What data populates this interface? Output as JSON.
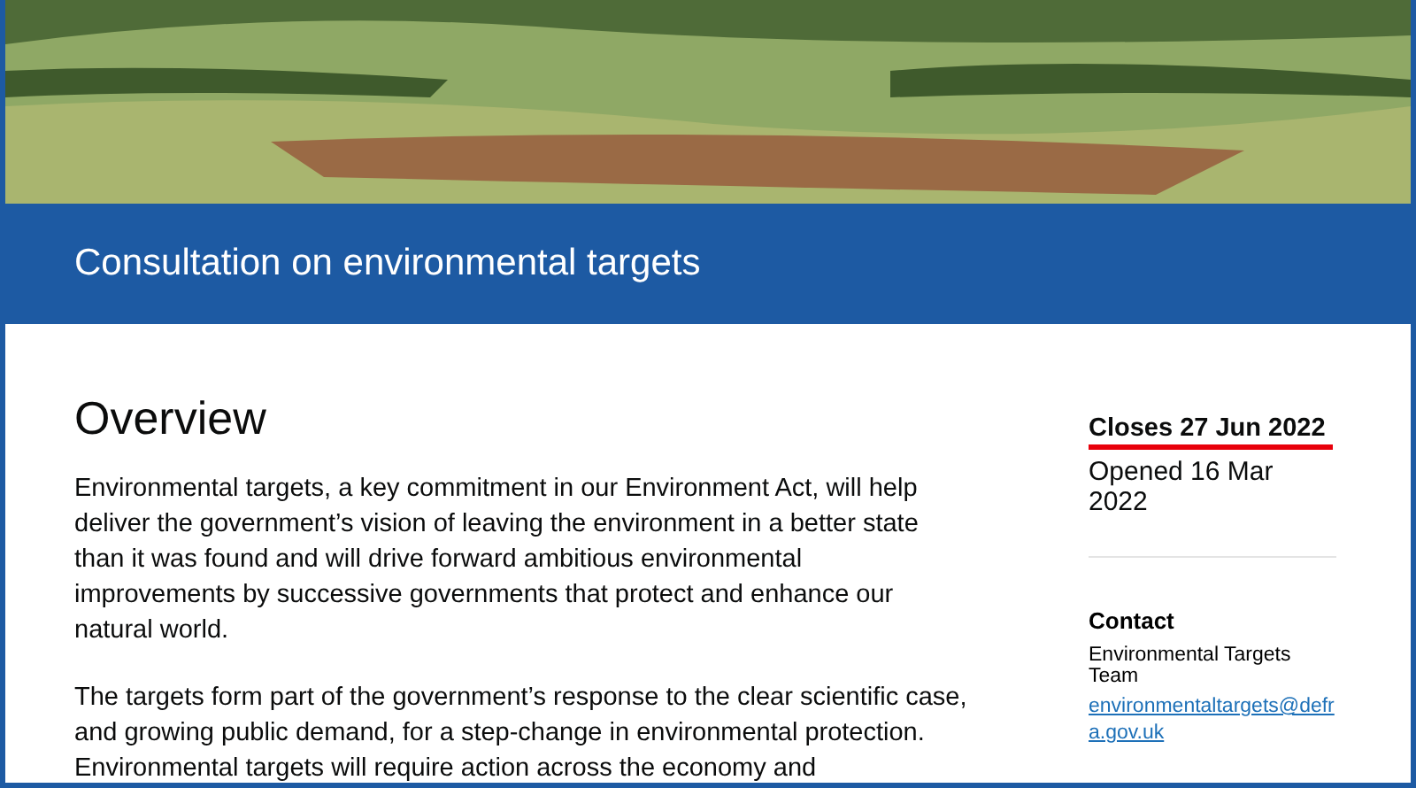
{
  "banner": {
    "title": "Consultation on environmental targets"
  },
  "overview": {
    "heading": "Overview",
    "paragraphs": [
      "Environmental targets, a key commitment in our Environment Act, will help deliver the government’s vision of leaving the environment in a better state than it was found and will drive forward ambitious environmental improvements by successive governments that protect and enhance our natural world.",
      "The targets form part of the government’s response to the clear scientific case, and growing public demand, for a step-change in environmental protection. Environmental targets will require action across the economy and"
    ]
  },
  "sidebar": {
    "closes": "Closes 27 Jun 2022",
    "closes_marked": true,
    "opened": "Opened 16 Mar 2022",
    "contact": {
      "heading": "Contact",
      "team": "Environmental Targets Team",
      "email": "environmentaltargets@defra.gov.uk"
    }
  }
}
